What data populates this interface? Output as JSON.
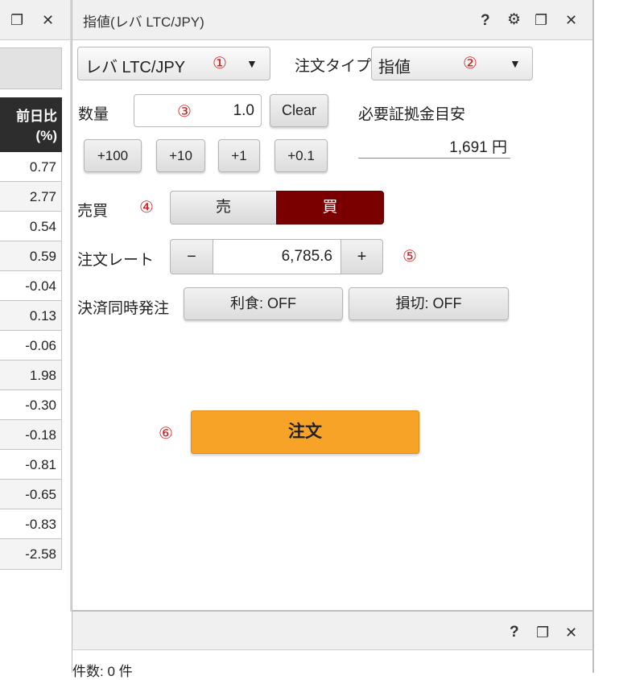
{
  "left_panel": {
    "column_header_line1": "前日比",
    "column_header_line2": "(%)",
    "rows": [
      "0.77",
      "2.77",
      "0.54",
      "0.59",
      "-0.04",
      "0.13",
      "-0.06",
      "1.98",
      "-0.30",
      "-0.18",
      "-0.81",
      "-0.65",
      "-0.83",
      "-2.58"
    ]
  },
  "header_icons": {
    "restore": "❐",
    "close": "✕",
    "help": "?",
    "gear": "⚙"
  },
  "window": {
    "title": "指値(レバ LTC/JPY)"
  },
  "symbol_select": {
    "value": "レバ LTC/JPY",
    "marker": "①"
  },
  "order_type": {
    "label": "注文タイプ",
    "value": "指値",
    "marker": "②"
  },
  "quantity": {
    "label": "数量",
    "value": "1.0",
    "marker": "③",
    "clear_label": "Clear"
  },
  "increments": [
    "+100",
    "+10",
    "+1",
    "+0.1"
  ],
  "margin": {
    "label": "必要証拠金目安",
    "value": "1,691 円"
  },
  "side": {
    "label": "売買",
    "marker": "④",
    "sell": "売",
    "buy": "買"
  },
  "rate": {
    "label": "注文レート",
    "minus": "−",
    "value": "6,785.6",
    "plus": "+",
    "marker": "⑤"
  },
  "settlement": {
    "label": "決済同時発注",
    "take_profit": "利食: OFF",
    "stop_loss": "損切: OFF"
  },
  "order": {
    "marker": "⑥",
    "label": "注文"
  },
  "bottom_panel": {
    "count_text": "件数: 0 件"
  },
  "colors": {
    "buy_active": "#7a0000",
    "order_button": "#f7a328",
    "marker_red": "#d21f1f",
    "column_header_bg": "#2d2d2d"
  }
}
